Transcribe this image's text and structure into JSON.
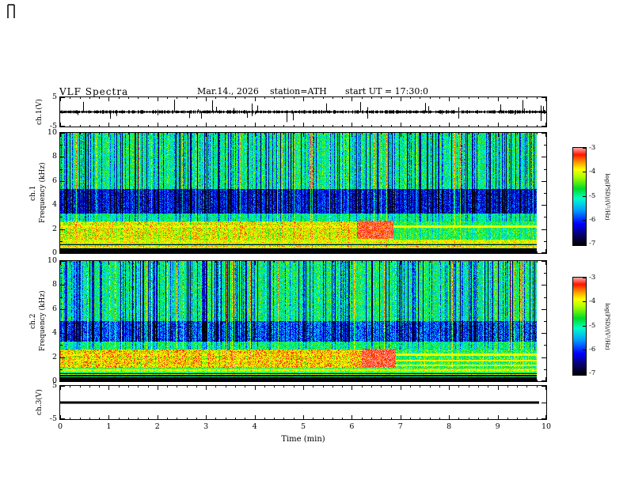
{
  "header": {
    "title": "VLF Spectra",
    "date": "Mar.14., 2026",
    "station": "station=ATH",
    "start_ut": "start UT =  17:30:0"
  },
  "axes": {
    "x": {
      "label": "Time (min)",
      "min": 0,
      "max": 10,
      "major_ticks": [
        0,
        1,
        2,
        3,
        4,
        5,
        6,
        7,
        8,
        9,
        10
      ],
      "tick_labels": [
        "0",
        "1",
        "2",
        "3",
        "4",
        "5",
        "6",
        "7",
        "8",
        "9",
        "10"
      ],
      "minor_per_major": 5
    },
    "wave": {
      "min": -5,
      "max": 5,
      "tick_values": [
        5,
        -5
      ],
      "tick_labels": [
        "5",
        "-5"
      ]
    },
    "spec": {
      "min": 0,
      "max": 10,
      "major_ticks": [
        10,
        8,
        6,
        4,
        2,
        0
      ],
      "tick_labels": [
        "10",
        "8",
        "6",
        "4",
        "2",
        "0"
      ],
      "minor_ticks": [
        9,
        7,
        5,
        3,
        1
      ]
    }
  },
  "panels": [
    {
      "id": "wave1",
      "ylabel": "ch.1(V)"
    },
    {
      "id": "spec1",
      "ylabel_ch": "ch.1",
      "ylabel_freq": "Frequency (kHz)"
    },
    {
      "id": "spec2",
      "ylabel_ch": "ch.2",
      "ylabel_freq": "Frequency (kHz)"
    },
    {
      "id": "wave3",
      "ylabel": "ch.3(V)"
    }
  ],
  "colorbar": {
    "label": "log(PSD)/(V²/Hz)",
    "min": -7,
    "max": -3,
    "tick_values": [
      -3,
      -4,
      -5,
      -6,
      -7
    ],
    "tick_labels": [
      "-3",
      "-4",
      "-5",
      "-6",
      "-7"
    ]
  },
  "colormap": {
    "stops": [
      [
        0.0,
        0,
        0,
        0
      ],
      [
        0.1,
        8,
        0,
        100
      ],
      [
        0.22,
        0,
        0,
        255
      ],
      [
        0.36,
        0,
        160,
        255
      ],
      [
        0.48,
        0,
        255,
        200
      ],
      [
        0.58,
        0,
        220,
        40
      ],
      [
        0.7,
        170,
        255,
        0
      ],
      [
        0.78,
        255,
        255,
        0
      ],
      [
        0.86,
        255,
        140,
        0
      ],
      [
        0.93,
        255,
        20,
        0
      ],
      [
        1.0,
        255,
        170,
        170
      ]
    ]
  },
  "chart_data": [
    {
      "id": "ch1_waveform",
      "type": "line",
      "panel": "ch.1(V)",
      "xlim": [
        0,
        10
      ],
      "ylim": [
        -5,
        5
      ],
      "seed": 11,
      "noise_amplitude": 0.55,
      "spike_rate": 0.055,
      "spike_amplitude": 3.6,
      "data_end_min": 10,
      "description": "Broadband noisy voltage trace centred on 0 V with impulsive sferic spikes reaching roughly ±2 to ±5 V throughout the 10 minute record"
    },
    {
      "id": "ch1_spectrogram",
      "type": "heatmap",
      "panel": "ch.1 Frequency (kHz)",
      "xlim": [
        0,
        10
      ],
      "ylim": [
        0,
        10
      ],
      "zlim": [
        -7,
        -3
      ],
      "zlabel": "log(PSD)/(V²/Hz)",
      "seed": 21,
      "data_end_min": 9.8,
      "bands": [
        {
          "f": [
            0,
            0.35
          ],
          "level": -7.0,
          "noise": 0.1
        },
        {
          "f": [
            0.35,
            1.1
          ],
          "level": -4.3,
          "noise": 0.6,
          "striped": true
        },
        {
          "f": [
            1.1,
            2.6
          ],
          "level": -3.9,
          "noise": 0.5,
          "cool_after": 6.85,
          "cool_level": -4.7
        },
        {
          "f": [
            2.6,
            3.3
          ],
          "level": -4.9,
          "noise": 0.4
        },
        {
          "f": [
            3.3,
            5.3
          ],
          "level": -6.1,
          "noise": 0.5
        },
        {
          "f": [
            5.3,
            10
          ],
          "level": -4.9,
          "noise": 0.55
        }
      ],
      "hot_rows": [
        2.2
      ],
      "hot_blob": {
        "t": [
          6.1,
          6.85
        ],
        "f": [
          1.2,
          2.7
        ],
        "level": -3.3
      },
      "description": "Strong hiss band 1-2.6 kHz (yellow/orange, about -4 log PSD) brightening to red near 6.5 min then weakening after ~6.9 min; banded yellow/green/black horizontal lines 0.4-1.1 kHz; quiet dark-blue band 3.3-5.3 kHz; mottled green/cyan background 5-10 kHz crossed by dense vertical sferic impulse streaks; black band below 0.35 kHz"
    },
    {
      "id": "ch2_spectrogram",
      "type": "heatmap",
      "panel": "ch.2 Frequency (kHz)",
      "xlim": [
        0,
        10
      ],
      "ylim": [
        0,
        10
      ],
      "zlim": [
        -7,
        -3
      ],
      "zlabel": "log(PSD)/(V²/Hz)",
      "seed": 22,
      "data_end_min": 9.8,
      "bands": [
        {
          "f": [
            0,
            0.35
          ],
          "level": -7.0,
          "noise": 0.1
        },
        {
          "f": [
            0.35,
            1.1
          ],
          "level": -4.2,
          "noise": 0.6,
          "striped": true
        },
        {
          "f": [
            1.1,
            2.6
          ],
          "level": -3.75,
          "noise": 0.55,
          "cool_after": 6.9,
          "cool_level": -4.6
        },
        {
          "f": [
            2.6,
            3.3
          ],
          "level": -4.8,
          "noise": 0.45
        },
        {
          "f": [
            3.3,
            5.0
          ],
          "level": -5.8,
          "noise": 0.55
        },
        {
          "f": [
            5.0,
            10
          ],
          "level": -4.9,
          "noise": 0.55
        }
      ],
      "hot_rows": [
        1.3,
        1.7,
        2.2
      ],
      "hot_blob": {
        "t": [
          6.2,
          6.9
        ],
        "f": [
          1.2,
          2.7
        ],
        "level": -3.25
      },
      "description": "Similar to ch.1 but hotter 1-2.6 kHz hiss band with more red patches and persistent thin yellow horizontal lines continuing after the ~6.9 min weakening"
    },
    {
      "id": "ch3_waveform",
      "type": "line",
      "panel": "ch.3(V)",
      "xlim": [
        0,
        10
      ],
      "ylim": [
        -5,
        5
      ],
      "constant": 0,
      "line_width": 3,
      "data_end_min": 9.85,
      "description": "Flat thick line at 0 V for the whole record (channel inactive)"
    }
  ]
}
